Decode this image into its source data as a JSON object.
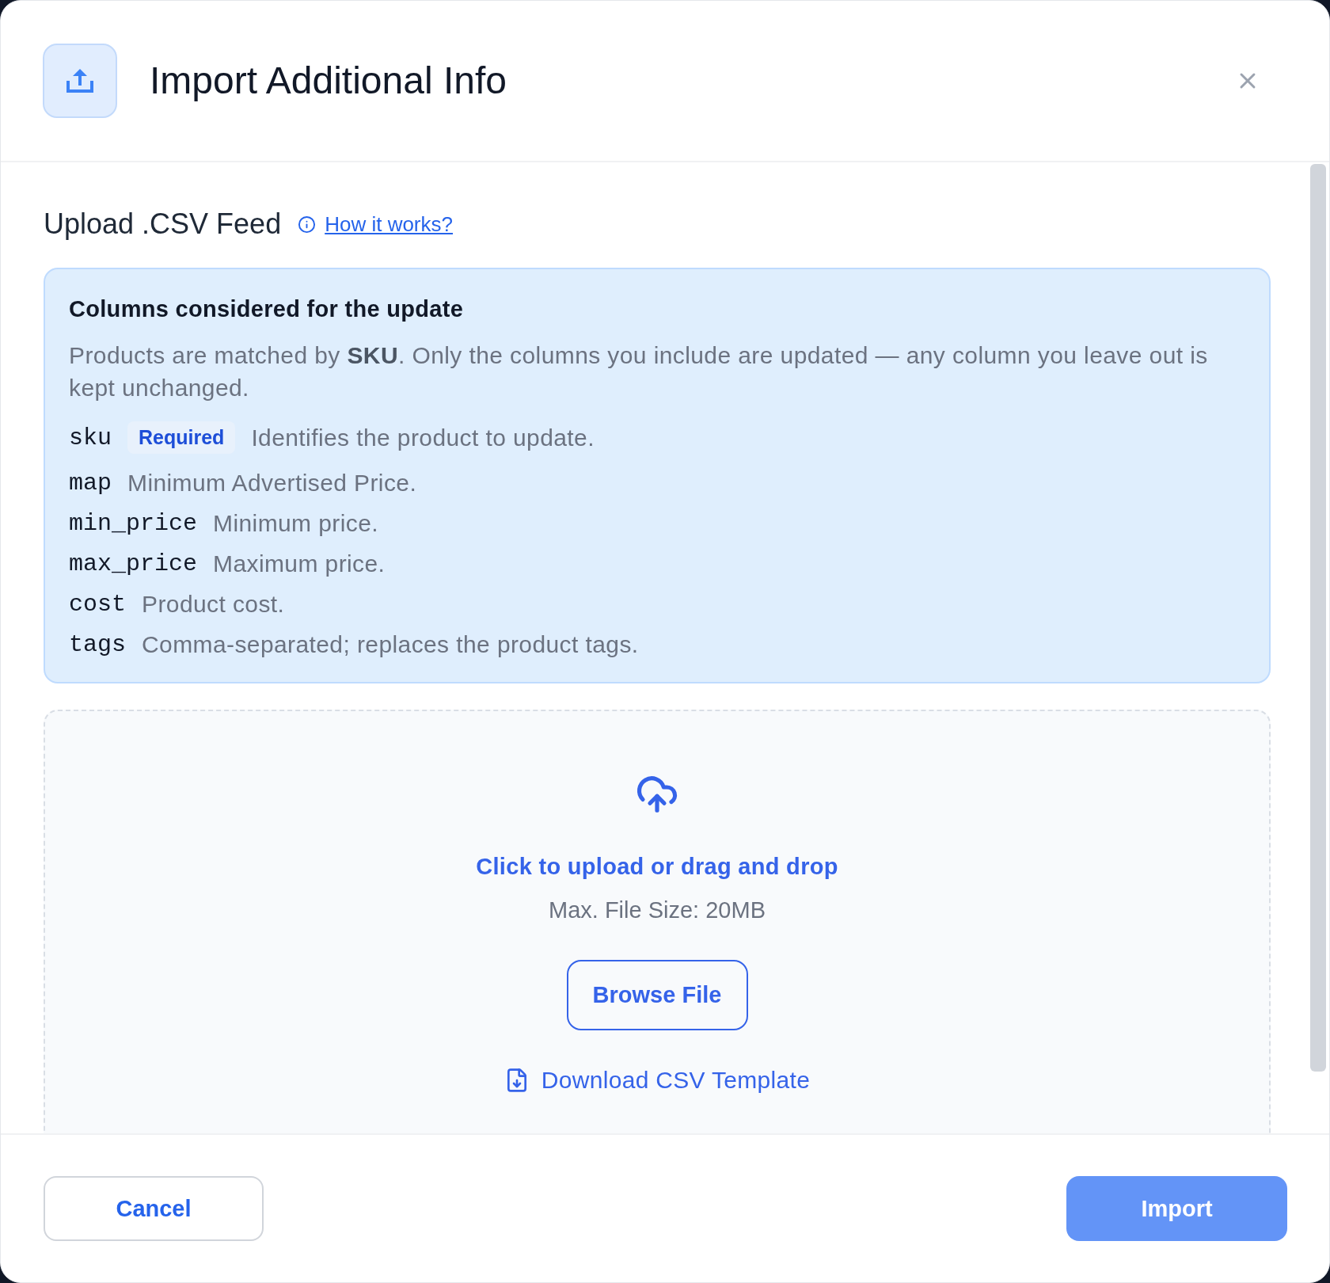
{
  "dialog": {
    "title": "Import Additional Info"
  },
  "section": {
    "title": "Upload .CSV Feed",
    "help_link": "How it works?"
  },
  "info_box": {
    "title": "Columns considered for the update",
    "description": "Products are matched by **SKU**. Only the columns you include are updated — any column you leave out is kept unchanged.",
    "columns": [
      {
        "name": "sku",
        "badge": "Required",
        "description": "Identifies the product to update."
      },
      {
        "name": "map",
        "description": "Minimum Advertised Price."
      },
      {
        "name": "min_price",
        "description": "Minimum price."
      },
      {
        "name": "max_price",
        "description": "Maximum price."
      },
      {
        "name": "cost",
        "description": "Product cost."
      },
      {
        "name": "tags",
        "description": "Comma-separated; replaces the product tags."
      }
    ]
  },
  "dropzone": {
    "prompt": "Click to upload or drag and drop",
    "limit": "Max. File Size: 20MB",
    "browse_button": "Browse File",
    "template_link": "Download CSV Template"
  },
  "footer": {
    "cancel": "Cancel",
    "import": {
      "label": "Import",
      "disabled": true
    }
  }
}
